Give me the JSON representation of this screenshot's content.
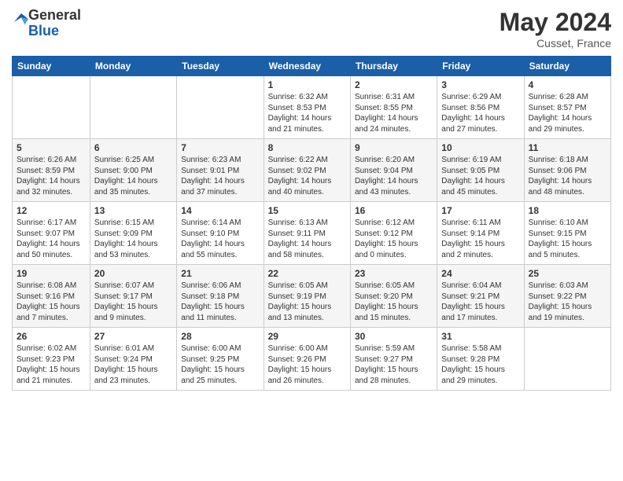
{
  "header": {
    "logo_general": "General",
    "logo_blue": "Blue",
    "month_title": "May 2024",
    "location": "Cusset, France"
  },
  "days_of_week": [
    "Sunday",
    "Monday",
    "Tuesday",
    "Wednesday",
    "Thursday",
    "Friday",
    "Saturday"
  ],
  "weeks": [
    [
      {
        "day": "",
        "info": ""
      },
      {
        "day": "",
        "info": ""
      },
      {
        "day": "",
        "info": ""
      },
      {
        "day": "1",
        "info": "Sunrise: 6:32 AM\nSunset: 8:53 PM\nDaylight: 14 hours\nand 21 minutes."
      },
      {
        "day": "2",
        "info": "Sunrise: 6:31 AM\nSunset: 8:55 PM\nDaylight: 14 hours\nand 24 minutes."
      },
      {
        "day": "3",
        "info": "Sunrise: 6:29 AM\nSunset: 8:56 PM\nDaylight: 14 hours\nand 27 minutes."
      },
      {
        "day": "4",
        "info": "Sunrise: 6:28 AM\nSunset: 8:57 PM\nDaylight: 14 hours\nand 29 minutes."
      }
    ],
    [
      {
        "day": "5",
        "info": "Sunrise: 6:26 AM\nSunset: 8:59 PM\nDaylight: 14 hours\nand 32 minutes."
      },
      {
        "day": "6",
        "info": "Sunrise: 6:25 AM\nSunset: 9:00 PM\nDaylight: 14 hours\nand 35 minutes."
      },
      {
        "day": "7",
        "info": "Sunrise: 6:23 AM\nSunset: 9:01 PM\nDaylight: 14 hours\nand 37 minutes."
      },
      {
        "day": "8",
        "info": "Sunrise: 6:22 AM\nSunset: 9:02 PM\nDaylight: 14 hours\nand 40 minutes."
      },
      {
        "day": "9",
        "info": "Sunrise: 6:20 AM\nSunset: 9:04 PM\nDaylight: 14 hours\nand 43 minutes."
      },
      {
        "day": "10",
        "info": "Sunrise: 6:19 AM\nSunset: 9:05 PM\nDaylight: 14 hours\nand 45 minutes."
      },
      {
        "day": "11",
        "info": "Sunrise: 6:18 AM\nSunset: 9:06 PM\nDaylight: 14 hours\nand 48 minutes."
      }
    ],
    [
      {
        "day": "12",
        "info": "Sunrise: 6:17 AM\nSunset: 9:07 PM\nDaylight: 14 hours\nand 50 minutes."
      },
      {
        "day": "13",
        "info": "Sunrise: 6:15 AM\nSunset: 9:09 PM\nDaylight: 14 hours\nand 53 minutes."
      },
      {
        "day": "14",
        "info": "Sunrise: 6:14 AM\nSunset: 9:10 PM\nDaylight: 14 hours\nand 55 minutes."
      },
      {
        "day": "15",
        "info": "Sunrise: 6:13 AM\nSunset: 9:11 PM\nDaylight: 14 hours\nand 58 minutes."
      },
      {
        "day": "16",
        "info": "Sunrise: 6:12 AM\nSunset: 9:12 PM\nDaylight: 15 hours\nand 0 minutes."
      },
      {
        "day": "17",
        "info": "Sunrise: 6:11 AM\nSunset: 9:14 PM\nDaylight: 15 hours\nand 2 minutes."
      },
      {
        "day": "18",
        "info": "Sunrise: 6:10 AM\nSunset: 9:15 PM\nDaylight: 15 hours\nand 5 minutes."
      }
    ],
    [
      {
        "day": "19",
        "info": "Sunrise: 6:08 AM\nSunset: 9:16 PM\nDaylight: 15 hours\nand 7 minutes."
      },
      {
        "day": "20",
        "info": "Sunrise: 6:07 AM\nSunset: 9:17 PM\nDaylight: 15 hours\nand 9 minutes."
      },
      {
        "day": "21",
        "info": "Sunrise: 6:06 AM\nSunset: 9:18 PM\nDaylight: 15 hours\nand 11 minutes."
      },
      {
        "day": "22",
        "info": "Sunrise: 6:05 AM\nSunset: 9:19 PM\nDaylight: 15 hours\nand 13 minutes."
      },
      {
        "day": "23",
        "info": "Sunrise: 6:05 AM\nSunset: 9:20 PM\nDaylight: 15 hours\nand 15 minutes."
      },
      {
        "day": "24",
        "info": "Sunrise: 6:04 AM\nSunset: 9:21 PM\nDaylight: 15 hours\nand 17 minutes."
      },
      {
        "day": "25",
        "info": "Sunrise: 6:03 AM\nSunset: 9:22 PM\nDaylight: 15 hours\nand 19 minutes."
      }
    ],
    [
      {
        "day": "26",
        "info": "Sunrise: 6:02 AM\nSunset: 9:23 PM\nDaylight: 15 hours\nand 21 minutes."
      },
      {
        "day": "27",
        "info": "Sunrise: 6:01 AM\nSunset: 9:24 PM\nDaylight: 15 hours\nand 23 minutes."
      },
      {
        "day": "28",
        "info": "Sunrise: 6:00 AM\nSunset: 9:25 PM\nDaylight: 15 hours\nand 25 minutes."
      },
      {
        "day": "29",
        "info": "Sunrise: 6:00 AM\nSunset: 9:26 PM\nDaylight: 15 hours\nand 26 minutes."
      },
      {
        "day": "30",
        "info": "Sunrise: 5:59 AM\nSunset: 9:27 PM\nDaylight: 15 hours\nand 28 minutes."
      },
      {
        "day": "31",
        "info": "Sunrise: 5:58 AM\nSunset: 9:28 PM\nDaylight: 15 hours\nand 29 minutes."
      },
      {
        "day": "",
        "info": ""
      }
    ]
  ]
}
